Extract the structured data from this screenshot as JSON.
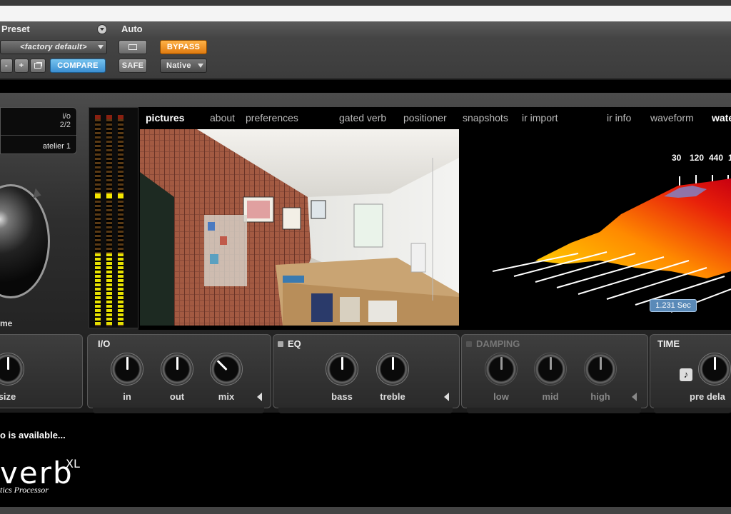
{
  "host": {
    "preset_label": "Preset",
    "auto_label": "Auto",
    "preset_value": "<factory default>",
    "minus": "-",
    "plus": "+",
    "compare": "COMPARE",
    "safe": "SAFE",
    "bypass": "BYPASS",
    "native": "Native"
  },
  "ir": {
    "io_label": "i/o",
    "io_value": "2/2",
    "name": "atelier 1"
  },
  "left": {
    "volume_label": "me"
  },
  "nav": [
    {
      "label": "pictures",
      "active": true
    },
    {
      "label": "about"
    },
    {
      "label": "preferences"
    },
    {
      "label": "gated verb"
    },
    {
      "label": "positioner"
    },
    {
      "label": "snapshots"
    },
    {
      "label": "ir import"
    },
    {
      "label": "ir info"
    },
    {
      "label": "waveform"
    },
    {
      "label": "wate"
    }
  ],
  "waterfall": {
    "freq_labels": [
      "30",
      "120",
      "440",
      "1"
    ],
    "time": "1.231 Sec"
  },
  "sections": {
    "size": {
      "knob_label": "size"
    },
    "io": {
      "title": "I/O",
      "knobs": [
        "in",
        "out",
        "mix"
      ]
    },
    "eq": {
      "title": "EQ",
      "knobs": [
        "bass",
        "treble"
      ]
    },
    "damping": {
      "title": "DAMPING",
      "knobs": [
        "low",
        "mid",
        "high"
      ]
    },
    "time": {
      "title": "TIME",
      "knobs": [
        "pre dela"
      ]
    }
  },
  "footer": {
    "update": "o is available...",
    "logo": "verb",
    "logo_sup": "XL",
    "logo_sub": "tics Processor"
  },
  "colors": {
    "bypass": "#f08a1a",
    "compare": "#4aa3e0",
    "meter_yellow": "#f5e700"
  }
}
